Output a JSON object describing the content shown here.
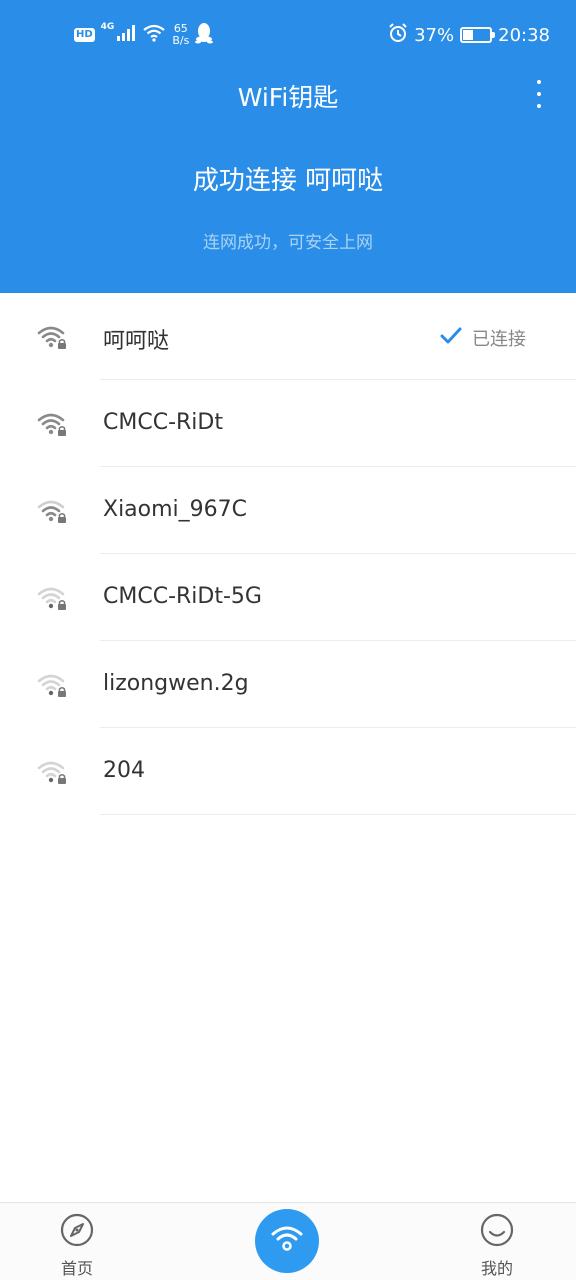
{
  "status_bar": {
    "hd": "HD",
    "network_type": "4G",
    "speed_value": "65",
    "speed_unit": "B/s",
    "battery": "37%",
    "battery_level": 0.37,
    "time": "20:38",
    "icons": [
      "signal-icon",
      "wifi-icon",
      "qq-icon",
      "alarm-icon",
      "battery-icon"
    ]
  },
  "app": {
    "title": "WiFi钥匙",
    "header_color": "#2a8ee8"
  },
  "connection": {
    "title": "成功连接 呵呵哒",
    "subtitle": "连网成功，可安全上网"
  },
  "networks": [
    {
      "name": "呵呵哒",
      "status": "已连接",
      "signal": "strong",
      "locked": true
    },
    {
      "name": "CMCC-RiDt",
      "status": "",
      "signal": "strong",
      "locked": true
    },
    {
      "name": "Xiaomi_967C",
      "status": "",
      "signal": "medium",
      "locked": true
    },
    {
      "name": "CMCC-RiDt-5G",
      "status": "",
      "signal": "weak",
      "locked": true
    },
    {
      "name": "lizongwen.2g",
      "status": "",
      "signal": "weak",
      "locked": true
    },
    {
      "name": "204",
      "status": "",
      "signal": "weak",
      "locked": true
    }
  ],
  "bottom_nav": {
    "home_label": "首页",
    "mine_label": "我的",
    "accent_color": "#2e9bf0"
  }
}
